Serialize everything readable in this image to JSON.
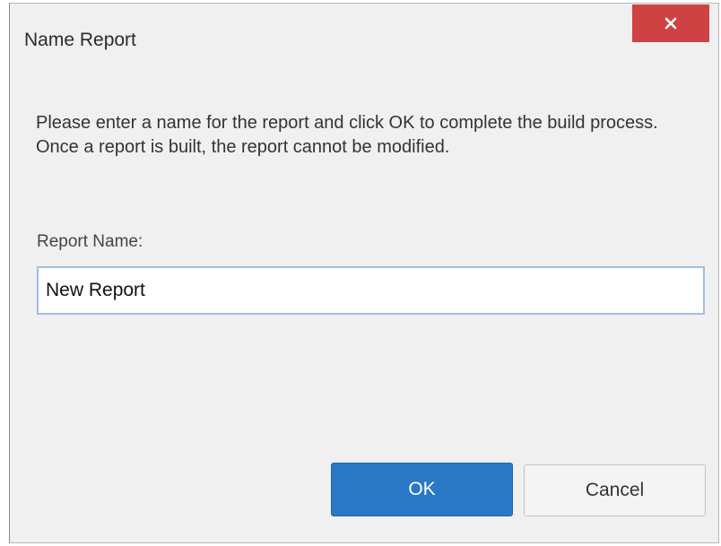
{
  "dialog": {
    "title": "Name Report",
    "close_icon": "close-icon",
    "message": "Please enter a name for the report and click OK to complete the build process. Once a report is built, the report cannot be modified.",
    "field_label": "Report Name:",
    "input_value": "New Report",
    "ok_label": "OK",
    "cancel_label": "Cancel"
  },
  "colors": {
    "close_button": "#cf4244",
    "ok_button": "#2a78c6",
    "dialog_background": "#f0f0f0",
    "input_border": "#9fbfe8"
  }
}
